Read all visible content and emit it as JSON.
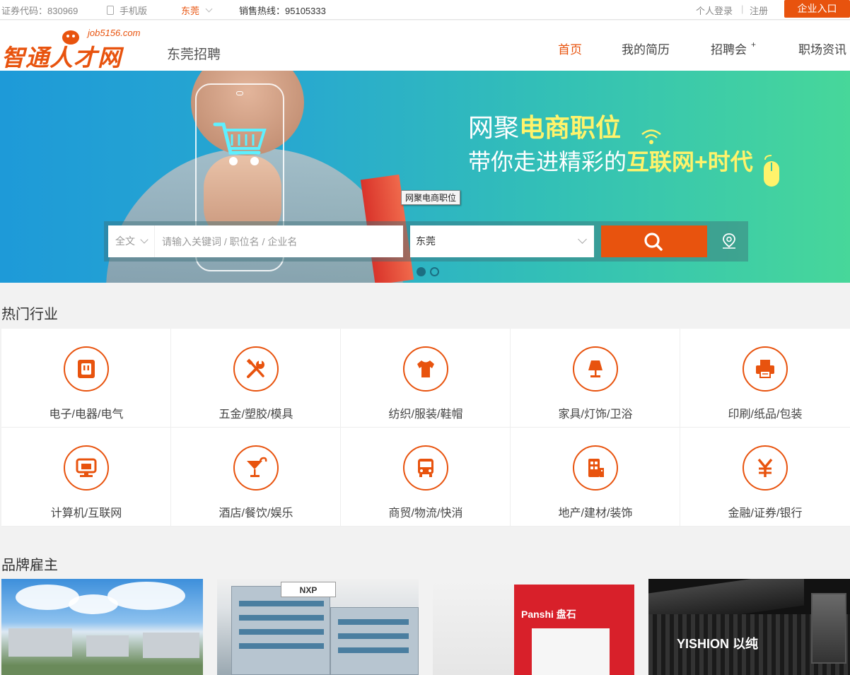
{
  "topbar": {
    "stock_code": "证券代码：830969",
    "mobile_label": "手机版",
    "city": "东莞",
    "hotline": "销售热线：95105333",
    "login": "个人登录",
    "separator": "|",
    "register": "注册",
    "company_entry": "企业入口"
  },
  "header": {
    "logo_text": "智通人才网",
    "logo_domain": "job5156.com",
    "site_city_label": "东莞招聘",
    "nav": {
      "home": "首页",
      "resume": "我的简历",
      "fair": "招聘会",
      "fair_suffix": "+",
      "news": "职场资讯"
    },
    "accent_color": "#e8530e"
  },
  "banner": {
    "line1_prefix": "网聚",
    "line1_highlight": "电商职位",
    "line2_prefix": "带你走进精彩的",
    "line2_highlight": "互联网+时代",
    "tooltip": "网聚电商职位",
    "slide_count": 2,
    "active_slide": 1
  },
  "search": {
    "type_label": "全文",
    "placeholder": "请输入关键词 / 职位名 / 企业名",
    "city_value": "东莞",
    "button_icon": "search-icon",
    "map_icon": "map-pin-icon"
  },
  "industries": {
    "title": "热门行业",
    "items": [
      {
        "label": "电子/电器/电气",
        "icon": "socket-icon"
      },
      {
        "label": "五金/塑胶/模具",
        "icon": "tools-icon"
      },
      {
        "label": "纺织/服装/鞋帽",
        "icon": "shirt-icon"
      },
      {
        "label": "家具/灯饰/卫浴",
        "icon": "lamp-icon"
      },
      {
        "label": "印刷/纸品/包装",
        "icon": "printer-icon"
      },
      {
        "label": "计算机/互联网",
        "icon": "computer-icon"
      },
      {
        "label": "酒店/餐饮/娱乐",
        "icon": "cocktail-icon"
      },
      {
        "label": "商贸/物流/快消",
        "icon": "bus-icon"
      },
      {
        "label": "地产/建材/装饰",
        "icon": "building-icon"
      },
      {
        "label": "金融/证券/银行",
        "icon": "yen-icon"
      }
    ]
  },
  "brands": {
    "title": "品牌雇主",
    "items": [
      {
        "alt": "factory-campus-photo"
      },
      {
        "alt": "nxp-office-building-photo",
        "sign": "NXP"
      },
      {
        "alt": "panshi-office-reception-photo",
        "sign": "Panshi 盘石"
      },
      {
        "alt": "yishion-storefront-photo",
        "sign": "YISHION 以纯"
      }
    ]
  }
}
